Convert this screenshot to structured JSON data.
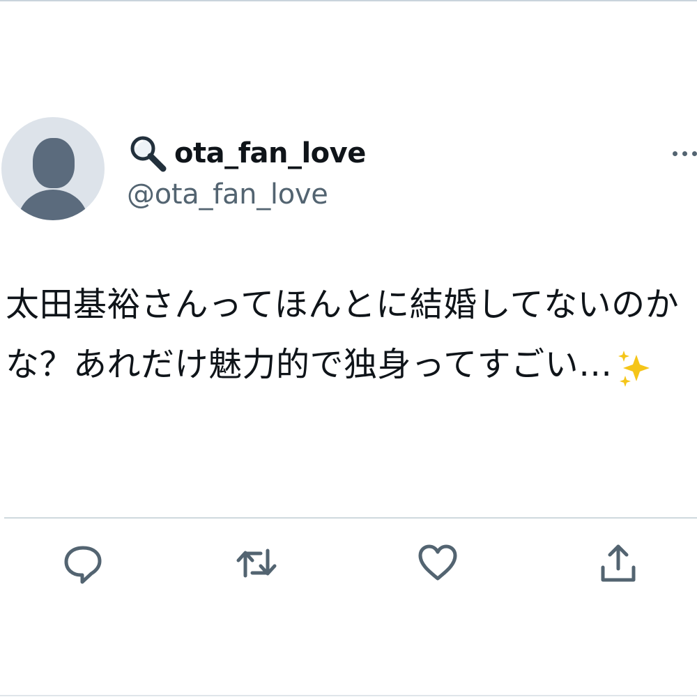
{
  "tweet": {
    "display_name": "ota_fan_love",
    "name_icon": "magnifying-glass-icon",
    "handle": "@ota_fan_love",
    "text": "太田基裕さんってほんとに結婚してないのかな？あれだけ魅力的で独身ってすごい…",
    "text_emoji": "sparkles-icon",
    "more_icon": "more-options-icon"
  },
  "actions": [
    {
      "name": "reply",
      "icon": "reply-icon"
    },
    {
      "name": "retweet",
      "icon": "retweet-icon"
    },
    {
      "name": "like",
      "icon": "heart-icon"
    },
    {
      "name": "share",
      "icon": "share-icon"
    }
  ],
  "colors": {
    "text_primary": "#0f1419",
    "text_secondary": "#536471",
    "icon_gray": "#536471",
    "divider": "#cfd9de",
    "avatar_bg": "#dde3ea",
    "avatar_fg": "#5b6b7d",
    "sparkle": "#f5c518"
  }
}
